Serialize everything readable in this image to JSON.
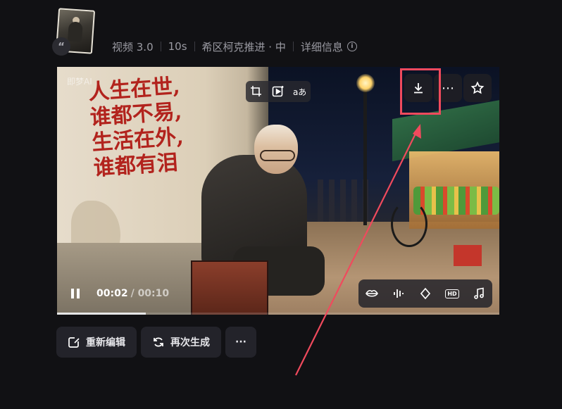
{
  "header": {
    "avatar_alt": "",
    "quote_glyph": "“",
    "meta": {
      "type": "视频 3.0",
      "duration": "10s",
      "style": "希区柯克推进 · 中",
      "details": "详细信息",
      "info_glyph": "i"
    }
  },
  "video": {
    "watermark": "即梦AI",
    "slogan": [
      "人生在世,",
      "谁都不易,",
      "生活在外,",
      "谁都有泪"
    ],
    "top_tools": {
      "aa_label": "aあ"
    },
    "top_actions": {
      "download": "download-icon",
      "more": "⋯",
      "favorite": "star-icon"
    },
    "controls": {
      "current_time": "00:02",
      "total_time": "/ 00:10",
      "progress_percent": 20
    },
    "right_tools": {
      "hd_label": "HD"
    }
  },
  "actions": {
    "reedit": "重新编辑",
    "regenerate": "再次生成",
    "more": "···"
  },
  "colors": {
    "accent_highlight": "#f04a5d",
    "slogan_red": "#b2231d"
  }
}
